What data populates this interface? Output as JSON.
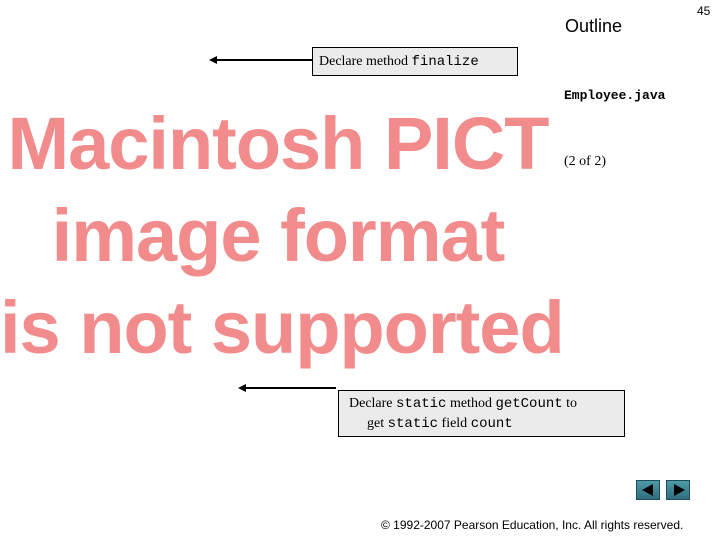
{
  "header": {
    "outline_label": "Outline",
    "page_number": "45"
  },
  "sidebar": {
    "filename": "Employee.java",
    "page_of": "(2 of 2)"
  },
  "callout_finalize": {
    "text_prefix": "Declare method ",
    "code": "finalize"
  },
  "callout_getcount": {
    "line1_prefix": "Declare ",
    "line1_code1": "static",
    "line1_mid": " method ",
    "line1_code2": "getCount",
    "line1_suffix": " to",
    "line2_prefix": "get ",
    "line2_code1": "static",
    "line2_mid": " field ",
    "line2_code2": "count"
  },
  "placeholder_image": {
    "lines": [
      "Macintosh PICT",
      "image format",
      "is not supported"
    ]
  },
  "nav": {
    "prev_icon": "left-triangle-icon",
    "next_icon": "right-triangle-icon"
  },
  "footer": {
    "copyright": "© 1992-2007 Pearson Education, Inc.  All rights reserved."
  }
}
